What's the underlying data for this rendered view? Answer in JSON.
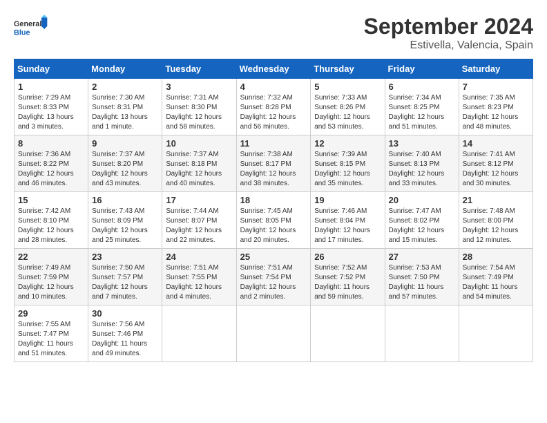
{
  "header": {
    "logo_general": "General",
    "logo_blue": "Blue",
    "month_title": "September 2024",
    "location": "Estivella, Valencia, Spain"
  },
  "days_of_week": [
    "Sunday",
    "Monday",
    "Tuesday",
    "Wednesday",
    "Thursday",
    "Friday",
    "Saturday"
  ],
  "weeks": [
    [
      {
        "day": "1",
        "sunrise": "7:29 AM",
        "sunset": "8:33 PM",
        "daylight": "13 hours and 3 minutes."
      },
      {
        "day": "2",
        "sunrise": "7:30 AM",
        "sunset": "8:31 PM",
        "daylight": "13 hours and 1 minute."
      },
      {
        "day": "3",
        "sunrise": "7:31 AM",
        "sunset": "8:30 PM",
        "daylight": "12 hours and 58 minutes."
      },
      {
        "day": "4",
        "sunrise": "7:32 AM",
        "sunset": "8:28 PM",
        "daylight": "12 hours and 56 minutes."
      },
      {
        "day": "5",
        "sunrise": "7:33 AM",
        "sunset": "8:26 PM",
        "daylight": "12 hours and 53 minutes."
      },
      {
        "day": "6",
        "sunrise": "7:34 AM",
        "sunset": "8:25 PM",
        "daylight": "12 hours and 51 minutes."
      },
      {
        "day": "7",
        "sunrise": "7:35 AM",
        "sunset": "8:23 PM",
        "daylight": "12 hours and 48 minutes."
      }
    ],
    [
      {
        "day": "8",
        "sunrise": "7:36 AM",
        "sunset": "8:22 PM",
        "daylight": "12 hours and 46 minutes."
      },
      {
        "day": "9",
        "sunrise": "7:37 AM",
        "sunset": "8:20 PM",
        "daylight": "12 hours and 43 minutes."
      },
      {
        "day": "10",
        "sunrise": "7:37 AM",
        "sunset": "8:18 PM",
        "daylight": "12 hours and 40 minutes."
      },
      {
        "day": "11",
        "sunrise": "7:38 AM",
        "sunset": "8:17 PM",
        "daylight": "12 hours and 38 minutes."
      },
      {
        "day": "12",
        "sunrise": "7:39 AM",
        "sunset": "8:15 PM",
        "daylight": "12 hours and 35 minutes."
      },
      {
        "day": "13",
        "sunrise": "7:40 AM",
        "sunset": "8:13 PM",
        "daylight": "12 hours and 33 minutes."
      },
      {
        "day": "14",
        "sunrise": "7:41 AM",
        "sunset": "8:12 PM",
        "daylight": "12 hours and 30 minutes."
      }
    ],
    [
      {
        "day": "15",
        "sunrise": "7:42 AM",
        "sunset": "8:10 PM",
        "daylight": "12 hours and 28 minutes."
      },
      {
        "day": "16",
        "sunrise": "7:43 AM",
        "sunset": "8:09 PM",
        "daylight": "12 hours and 25 minutes."
      },
      {
        "day": "17",
        "sunrise": "7:44 AM",
        "sunset": "8:07 PM",
        "daylight": "12 hours and 22 minutes."
      },
      {
        "day": "18",
        "sunrise": "7:45 AM",
        "sunset": "8:05 PM",
        "daylight": "12 hours and 20 minutes."
      },
      {
        "day": "19",
        "sunrise": "7:46 AM",
        "sunset": "8:04 PM",
        "daylight": "12 hours and 17 minutes."
      },
      {
        "day": "20",
        "sunrise": "7:47 AM",
        "sunset": "8:02 PM",
        "daylight": "12 hours and 15 minutes."
      },
      {
        "day": "21",
        "sunrise": "7:48 AM",
        "sunset": "8:00 PM",
        "daylight": "12 hours and 12 minutes."
      }
    ],
    [
      {
        "day": "22",
        "sunrise": "7:49 AM",
        "sunset": "7:59 PM",
        "daylight": "12 hours and 10 minutes."
      },
      {
        "day": "23",
        "sunrise": "7:50 AM",
        "sunset": "7:57 PM",
        "daylight": "12 hours and 7 minutes."
      },
      {
        "day": "24",
        "sunrise": "7:51 AM",
        "sunset": "7:55 PM",
        "daylight": "12 hours and 4 minutes."
      },
      {
        "day": "25",
        "sunrise": "7:51 AM",
        "sunset": "7:54 PM",
        "daylight": "12 hours and 2 minutes."
      },
      {
        "day": "26",
        "sunrise": "7:52 AM",
        "sunset": "7:52 PM",
        "daylight": "11 hours and 59 minutes."
      },
      {
        "day": "27",
        "sunrise": "7:53 AM",
        "sunset": "7:50 PM",
        "daylight": "11 hours and 57 minutes."
      },
      {
        "day": "28",
        "sunrise": "7:54 AM",
        "sunset": "7:49 PM",
        "daylight": "11 hours and 54 minutes."
      }
    ],
    [
      {
        "day": "29",
        "sunrise": "7:55 AM",
        "sunset": "7:47 PM",
        "daylight": "11 hours and 51 minutes."
      },
      {
        "day": "30",
        "sunrise": "7:56 AM",
        "sunset": "7:46 PM",
        "daylight": "11 hours and 49 minutes."
      },
      null,
      null,
      null,
      null,
      null
    ]
  ]
}
